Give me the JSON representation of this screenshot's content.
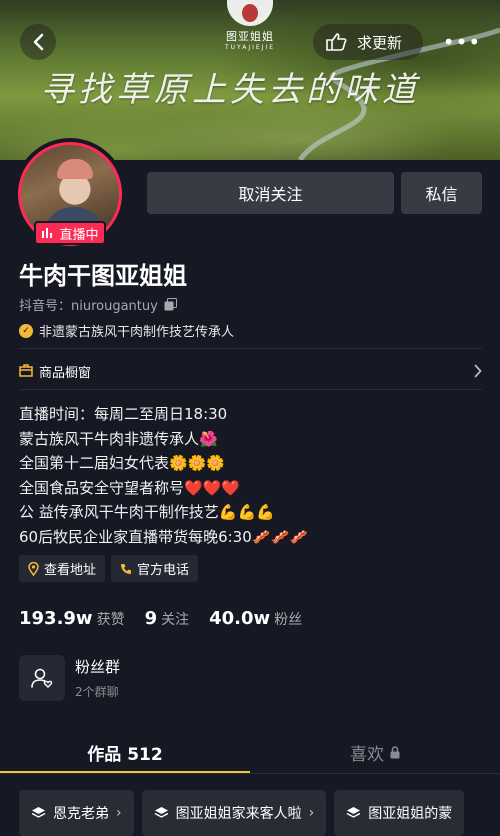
{
  "banner": {
    "logo_text": "图亚姐姐",
    "logo_sub": "TUYAJIEJIE",
    "slogan": "寻找草原上失去的味道"
  },
  "topbar": {
    "update_label": "求更新",
    "more_glyph": "•••"
  },
  "profile": {
    "live_label": "直播中",
    "unfollow_label": "取消关注",
    "message_label": "私信",
    "name": "牛肉干图亚姐姐",
    "douyin_id": "抖音号：niurougantuy",
    "verification": "非遗蒙古族风干肉制作技艺传承人"
  },
  "shop": {
    "label": "商品橱窗"
  },
  "bio": [
    "直播时间：每周二至周日18:30",
    "蒙古族风干牛肉非遗传承人🌺",
    "全国第十二届妇女代表🌼🌼🌼",
    "全国食品安全守望者称号❤️❤️❤️",
    "公 益传承风干牛肉干制作技艺💪💪💪",
    "60后牧民企业家直播带货每晚6:30🥓🥓🥓"
  ],
  "chips": {
    "address_label": "查看地址",
    "phone_label": "官方电话"
  },
  "stats": {
    "likes_value": "193.9w",
    "likes_label": "获赞",
    "following_value": "9",
    "following_label": "关注",
    "followers_value": "40.0w",
    "followers_label": "粉丝"
  },
  "fan_group": {
    "title": "粉丝群",
    "subtitle": "2个群聊"
  },
  "tabs": {
    "works_label": "作品 512",
    "likes_label": "喜欢"
  },
  "collections": [
    {
      "label": "恩克老弟"
    },
    {
      "label": "图亚姐姐家来客人啦"
    },
    {
      "label": "图亚姐姐的蒙"
    }
  ],
  "colors": {
    "background": "#161823",
    "accent_red": "#fe2c55",
    "accent_gold": "#f5c33b",
    "button_gray": "#393b44"
  }
}
